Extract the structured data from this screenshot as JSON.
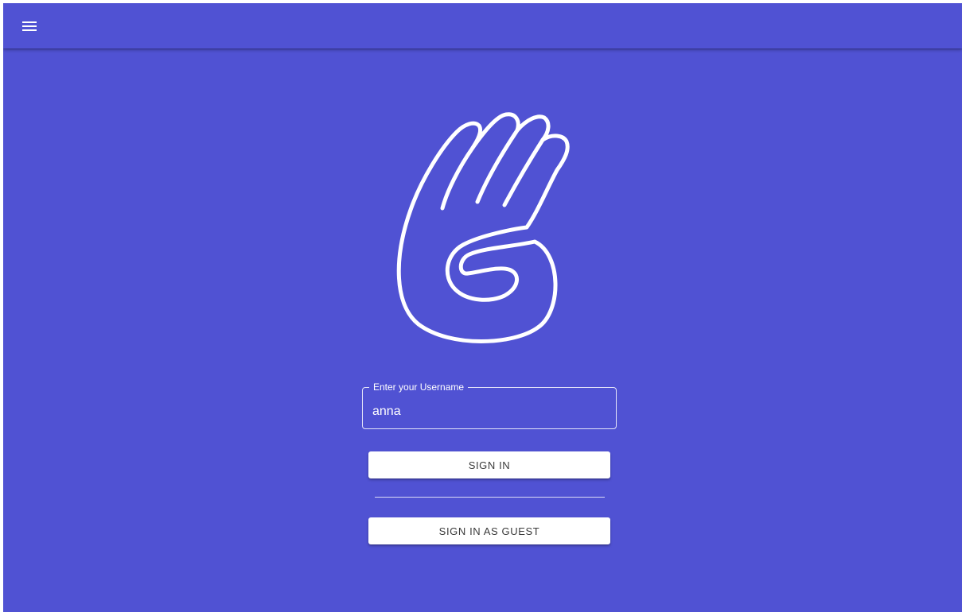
{
  "appbar": {
    "menu_icon": "hamburger-menu-icon"
  },
  "logo": {
    "icon": "hand-logo-icon"
  },
  "login": {
    "username_label": "Enter your Username",
    "username_value": "anna",
    "signin_label": "SIGN IN",
    "guest_label": "SIGN IN AS GUEST"
  },
  "colors": {
    "background": "#5052d3",
    "button_bg": "#ffffff",
    "button_text": "#3a3a3a"
  }
}
